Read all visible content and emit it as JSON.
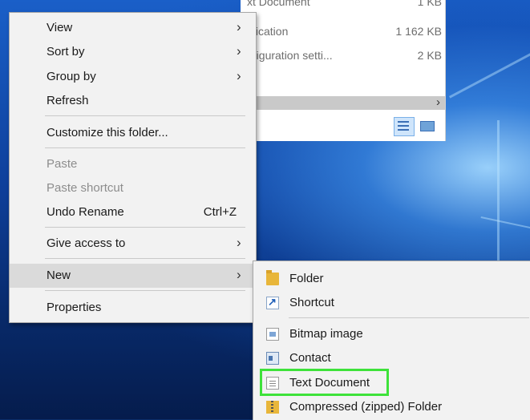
{
  "explorer": {
    "rows": [
      {
        "name": "xt Document",
        "size": "1 KB"
      },
      {
        "name": "plication",
        "size": "1 162 KB"
      },
      {
        "name": "nfiguration setti...",
        "size": "2 KB"
      }
    ],
    "scroll_arrow": "›",
    "view_buttons": [
      "details-view-icon",
      "large-icons-view-icon"
    ]
  },
  "context_menu": {
    "view": "View",
    "sort_by": "Sort by",
    "group_by": "Group by",
    "refresh": "Refresh",
    "customize": "Customize this folder...",
    "paste": "Paste",
    "paste_shortcut": "Paste shortcut",
    "undo_rename": "Undo Rename",
    "undo_rename_shortcut": "Ctrl+Z",
    "give_access": "Give access to",
    "new": "New",
    "properties": "Properties",
    "submenu_arrow": "›"
  },
  "new_submenu": {
    "folder": "Folder",
    "shortcut": "Shortcut",
    "bitmap": "Bitmap image",
    "contact": "Contact",
    "text_document": "Text Document",
    "compressed": "Compressed (zipped) Folder"
  },
  "colors": {
    "highlight_box": "#3ee23a",
    "menu_bg": "#f2f2f2",
    "hover_bg": "#dadada"
  }
}
